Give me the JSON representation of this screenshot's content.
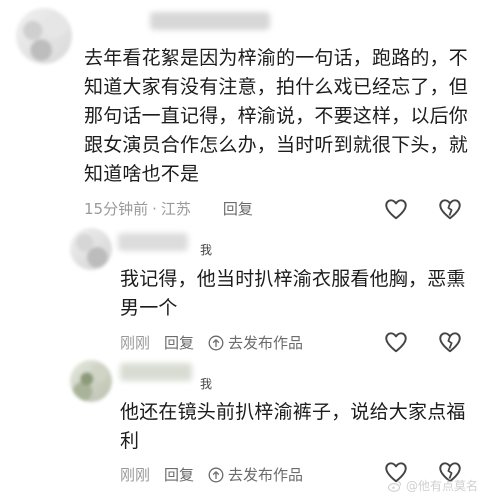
{
  "comments": [
    {
      "text": "去年看花絮是因为梓渝的一句话，跑路的，不知道大家有没有注意，拍什么戏已经忘了，但那句话一直记得，梓渝说，不要这样，以后你跟女演员合作怎么办，当时听到就很下头，就知道啥也不是",
      "time": "15分钟前",
      "location": "江苏",
      "reply_label": "回复"
    }
  ],
  "replies": [
    {
      "badge": "我",
      "text": "我记得，他当时扒梓渝衣服看他胸，恶熏男一个",
      "time": "刚刚",
      "reply_label": "回复",
      "post_label": "去发布作品"
    },
    {
      "badge": "我",
      "text": "他还在镜头前扒梓渝裤子，说给大家点福利",
      "time": "刚刚",
      "reply_label": "回复",
      "post_label": "去发布作品"
    }
  ],
  "watermark": {
    "text": "@他有点莫名"
  }
}
